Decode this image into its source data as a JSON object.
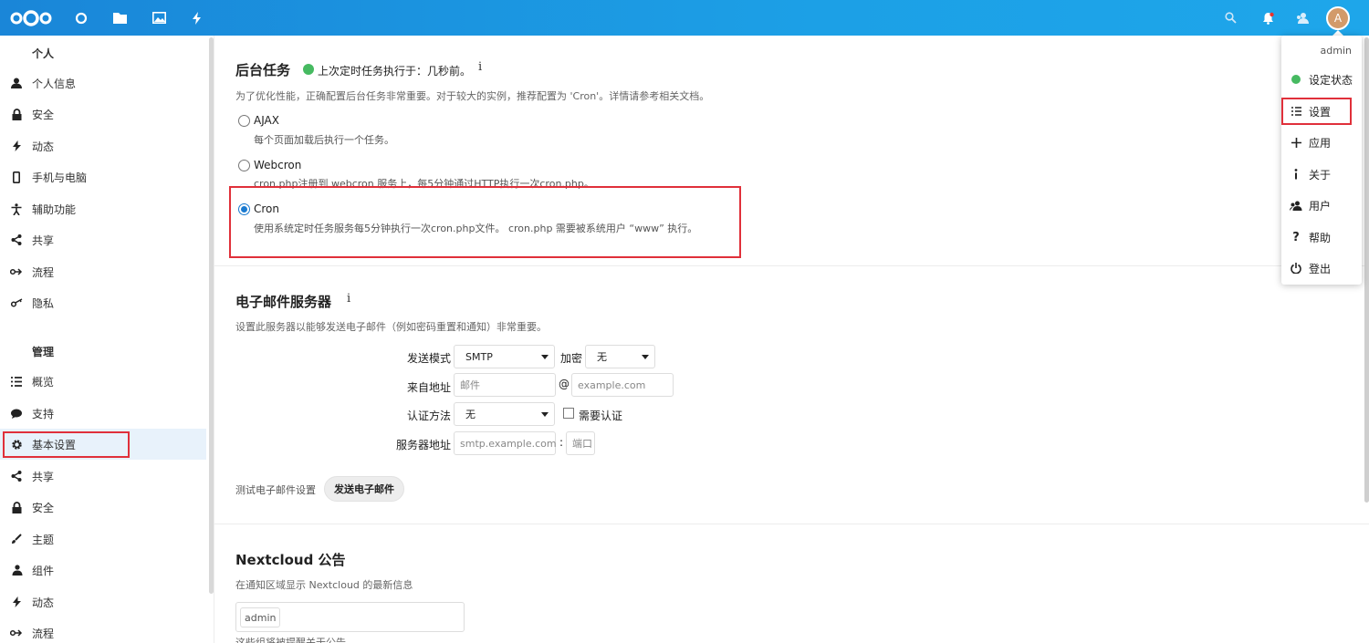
{
  "header": {
    "icons": [
      "nextcloud-logo",
      "dashboard-icon",
      "files-icon",
      "photos-icon",
      "activity-icon"
    ],
    "right_icons": [
      "search-icon",
      "notifications-icon",
      "contacts-icon"
    ],
    "avatar_letter": "A",
    "accent": "#1ca0e6"
  },
  "sidebar": {
    "personal_caption": "个人",
    "personal_items": [
      {
        "label": "个人信息",
        "icon": "user-icon"
      },
      {
        "label": "安全",
        "icon": "lock-icon"
      },
      {
        "label": "动态",
        "icon": "lightning-icon"
      },
      {
        "label": "手机与电脑",
        "icon": "phone-icon"
      },
      {
        "label": "辅助功能",
        "icon": "accessibility-icon"
      },
      {
        "label": "共享",
        "icon": "share-icon"
      },
      {
        "label": "流程",
        "icon": "flow-icon"
      },
      {
        "label": "隐私",
        "icon": "key-icon"
      }
    ],
    "admin_caption": "管理",
    "admin_items": [
      {
        "label": "概览",
        "icon": "list-icon"
      },
      {
        "label": "支持",
        "icon": "comment-icon"
      },
      {
        "label": "基本设置",
        "icon": "gear-icon"
      },
      {
        "label": "共享",
        "icon": "share-icon"
      },
      {
        "label": "安全",
        "icon": "lock-icon"
      },
      {
        "label": "主题",
        "icon": "brush-icon"
      },
      {
        "label": "组件",
        "icon": "group-icon"
      },
      {
        "label": "动态",
        "icon": "lightning-icon"
      },
      {
        "label": "流程",
        "icon": "flow-icon"
      }
    ]
  },
  "background_jobs": {
    "title": "后台任务",
    "status": "上次定时任务执行于：几秒前。",
    "status_color": "#46ba61",
    "info_glyph": "i",
    "description": "为了优化性能，正确配置后台任务非常重要。对于较大的实例，推荐配置为 'Cron'。详情请参考相关文档。",
    "options": [
      {
        "label": "AJAX",
        "desc": "每个页面加载后执行一个任务。"
      },
      {
        "label": "Webcron",
        "desc": "cron.php注册到 webcron 服务上，每5分钟通过HTTP执行一次cron.php。"
      },
      {
        "label": "Cron",
        "desc": "使用系统定时任务服务每5分钟执行一次cron.php文件。 cron.php 需要被系统用户 “www” 执行。"
      }
    ],
    "selected": "Cron"
  },
  "email": {
    "title": "电子邮件服务器",
    "info_glyph": "i",
    "description": "设置此服务器以能够发送电子邮件（例如密码重置和通知）非常重要。",
    "send_mode_label": "发送模式",
    "send_mode_value": "SMTP",
    "encryption_label": "加密",
    "encryption_value": "无",
    "from_label": "来自地址",
    "from_placeholder": "邮件",
    "at_sign": "@",
    "domain_placeholder": "example.com",
    "auth_label": "认证方法",
    "auth_value": "无",
    "auth_required_label": "需要认证",
    "server_label": "服务器地址",
    "server_placeholder": "smtp.example.com",
    "colon": ":",
    "port_placeholder": "端口",
    "test_label": "测试电子邮件设置",
    "send_button": "发送电子邮件"
  },
  "news": {
    "title": "Nextcloud 公告",
    "description": "在通知区域显示 Nextcloud 的最新信息",
    "group_tag": "admin",
    "cut_text": "这些组将被提醒关于公告"
  },
  "user_menu": {
    "username": "admin",
    "status_dot_color": "#46ba61",
    "items": [
      {
        "label": "设定状态",
        "icon": "status-dot-icon"
      },
      {
        "label": "设置",
        "icon": "settings-list-icon"
      },
      {
        "label": "应用",
        "icon": "plus-icon"
      },
      {
        "label": "关于",
        "icon": "info-icon"
      },
      {
        "label": "用户",
        "icon": "users-icon"
      },
      {
        "label": "帮助",
        "icon": "help-icon"
      },
      {
        "label": "登出",
        "icon": "power-icon"
      }
    ]
  }
}
